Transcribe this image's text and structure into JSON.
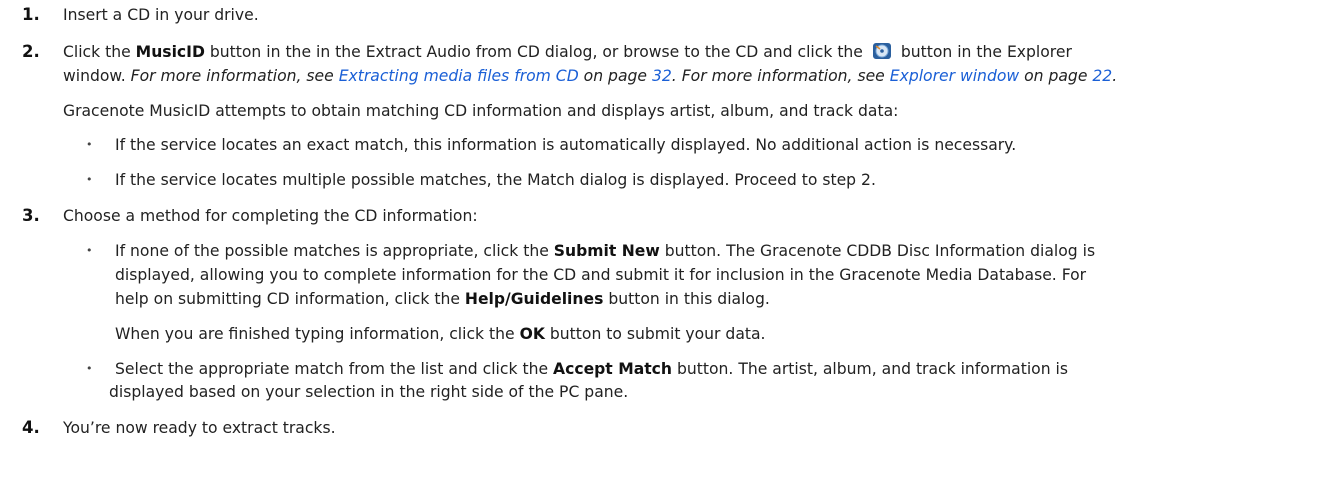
{
  "steps": [
    {
      "num": "1.",
      "text": "Insert a CD in your drive."
    },
    {
      "num": "2.",
      "a": "Click the ",
      "b1": "MusicID",
      "c": " button in the in the Extract Audio from CD dialog, or browse to the CD and click the ",
      "d": " button in the Explorer",
      "e": "window. ",
      "f": "For more information, see ",
      "link1": "Extracting media files from CD",
      "g": " on page ",
      "page1": "32",
      "h": ". For more information, see ",
      "link2": "Explorer window",
      "j": " on page ",
      "page2": "22",
      "k": ".",
      "para": "Gracenote MusicID attempts to obtain matching CD information and displays artist, album, and track data:",
      "bullets": [
        "If the service locates an exact match, this information is automatically displayed. No additional action is necessary.",
        "If the service locates multiple possible matches, the Match dialog is displayed. Proceed to step 2."
      ]
    },
    {
      "num": "3.",
      "text": "Choose a method for completing the CD information:",
      "b1_a": "If none of the possible matches is appropriate, click the ",
      "b1_b": "Submit New",
      "b1_c": " button. The Gracenote CDDB Disc Information dialog is",
      "b1_l2": "displayed, allowing you to complete information for the CD and submit it for inclusion in the Gracenote Media Database. For",
      "b1_l3a": "help on submitting CD information, click the ",
      "b1_l3b": "Help/Guidelines",
      "b1_l3c": " button in this dialog.",
      "b1_p_a": "When you are finished typing information, click the ",
      "b1_p_b": "OK",
      "b1_p_c": " button to submit your data.",
      "b2_a": "Select the appropriate match from the list and click the ",
      "b2_b": "Accept Match",
      "b2_c": " button. The artist, album, and track information is",
      "b2_l2": "displayed based on your selection in the right side of the PC pane."
    },
    {
      "num": "4.",
      "text": "You’re now ready to extract tracks."
    }
  ],
  "bullet_char": "•",
  "icons": {
    "cd": "musicid-cd-icon"
  },
  "colors": {
    "link": "#1a5fd6",
    "text": "#222222"
  }
}
